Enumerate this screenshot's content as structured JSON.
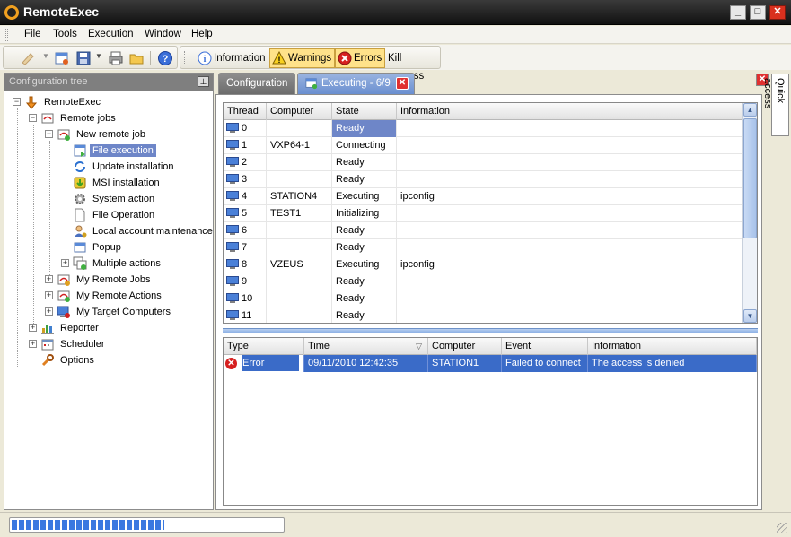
{
  "app": {
    "title": "RemoteExec"
  },
  "window_controls": {
    "minimize": "_",
    "maximize": "□",
    "close": "✕"
  },
  "menu": [
    "File",
    "Tools",
    "Execution",
    "Window",
    "Help"
  ],
  "toolbar": {
    "information_label": "Information",
    "warnings_label": "Warnings",
    "errors_label": "Errors",
    "kill_label": "Kill process"
  },
  "left_panel": {
    "title": "Configuration tree",
    "tree": {
      "root": "RemoteExec",
      "remote_jobs": "Remote jobs",
      "new_remote_job": "New remote job",
      "file_execution": "File execution",
      "update_installation": "Update installation",
      "msi_installation": "MSI installation",
      "system_action": "System action",
      "file_operation": "File Operation",
      "local_account_maintenance": "Local account maintenance",
      "popup": "Popup",
      "multiple_actions": "Multiple actions",
      "my_remote_jobs": "My Remote Jobs",
      "my_remote_actions": "My Remote Actions",
      "my_target_computers": "My Target Computers",
      "reporter": "Reporter",
      "scheduler": "Scheduler",
      "options": "Options"
    }
  },
  "tabs": {
    "configuration": "Configuration",
    "executing": "Executing - 6/9"
  },
  "thread_table": {
    "headers": [
      "Thread",
      "Computer",
      "State",
      "Information"
    ],
    "rows": [
      [
        "0",
        "",
        "Ready",
        ""
      ],
      [
        "1",
        "VXP64-1",
        "Connecting",
        ""
      ],
      [
        "2",
        "",
        "Ready",
        ""
      ],
      [
        "3",
        "",
        "Ready",
        ""
      ],
      [
        "4",
        "STATION4",
        "Executing",
        "ipconfig"
      ],
      [
        "5",
        "TEST1",
        "Initializing",
        ""
      ],
      [
        "6",
        "",
        "Ready",
        ""
      ],
      [
        "7",
        "",
        "Ready",
        ""
      ],
      [
        "8",
        "VZEUS",
        "Executing",
        "ipconfig"
      ],
      [
        "9",
        "",
        "Ready",
        ""
      ],
      [
        "10",
        "",
        "Ready",
        ""
      ],
      [
        "11",
        "",
        "Ready",
        ""
      ]
    ]
  },
  "log_table": {
    "headers": [
      "Type",
      "Time",
      "Computer",
      "Event",
      "Information"
    ],
    "sort_indicator": "▽",
    "rows": [
      [
        "Error",
        "09/11/2010 12:42:35",
        "STATION1",
        "Failed to connect",
        "The access is denied"
      ]
    ]
  },
  "quick_access": {
    "label": "Quick access"
  },
  "status": {
    "progress": 0.56,
    "accent": "#3a78e0"
  }
}
